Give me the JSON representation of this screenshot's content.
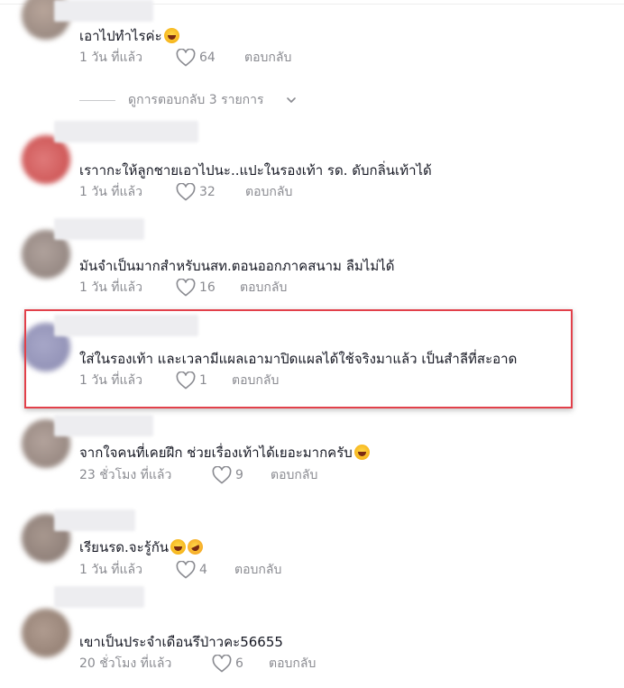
{
  "colors": {
    "highlight": "#e2404a",
    "meta_text": "#8a8b91",
    "primary_text": "#161823"
  },
  "comments": [
    {
      "text": "เอาไปทำไรค่ะ",
      "emoji": [
        "laughing-face"
      ],
      "time": "1 วัน ที่แล้ว",
      "likes": "64",
      "reply": "ตอบกลับ"
    },
    {
      "text": "เราากะให้ลูกชายเอาไปนะ..แปะในรองเท้า รด. ดับกลิ่นเท้าได้",
      "emoji": [],
      "time": "1 วัน ที่แล้ว",
      "likes": "32",
      "reply": "ตอบกลับ"
    },
    {
      "text": "มันจำเป็นมากสำหรับนสท.ตอนออกภาคสนาม ลืมไม่ได้",
      "emoji": [],
      "time": "1 วัน ที่แล้ว",
      "likes": "16",
      "reply": "ตอบกลับ"
    },
    {
      "text": "ใส่ในรองเท้า และเวลามีแผลเอามาปิดแผลได้ใช้จริงมาแล้ว เป็นสำลีที่สะอาด",
      "emoji": [],
      "time": "1 วัน ที่แล้ว",
      "likes": "1",
      "reply": "ตอบกลับ"
    },
    {
      "text": "จากใจคนที่เคยฝึก ช่วยเรื่องเท้าได้เยอะมากครับ",
      "emoji": [
        "laughing-face"
      ],
      "time": "23 ชั่วโมง ที่แล้ว",
      "likes": "9",
      "reply": "ตอบกลับ"
    },
    {
      "text": "เรียนรด.จะรู้กัน",
      "emoji": [
        "laughing-face",
        "rofl-face"
      ],
      "time": "1 วัน ที่แล้ว",
      "likes": "4",
      "reply": "ตอบกลับ"
    },
    {
      "text": "เขาเป็นประจำเดือนรึป่าวคะ56655",
      "emoji": [],
      "time": "20 ชั่วโมง ที่แล้ว",
      "likes": "6",
      "reply": "ตอบกลับ"
    }
  ],
  "view_replies": {
    "label": "ดูการตอบกลับ 3 รายการ",
    "icon": "chevron-down-icon"
  }
}
